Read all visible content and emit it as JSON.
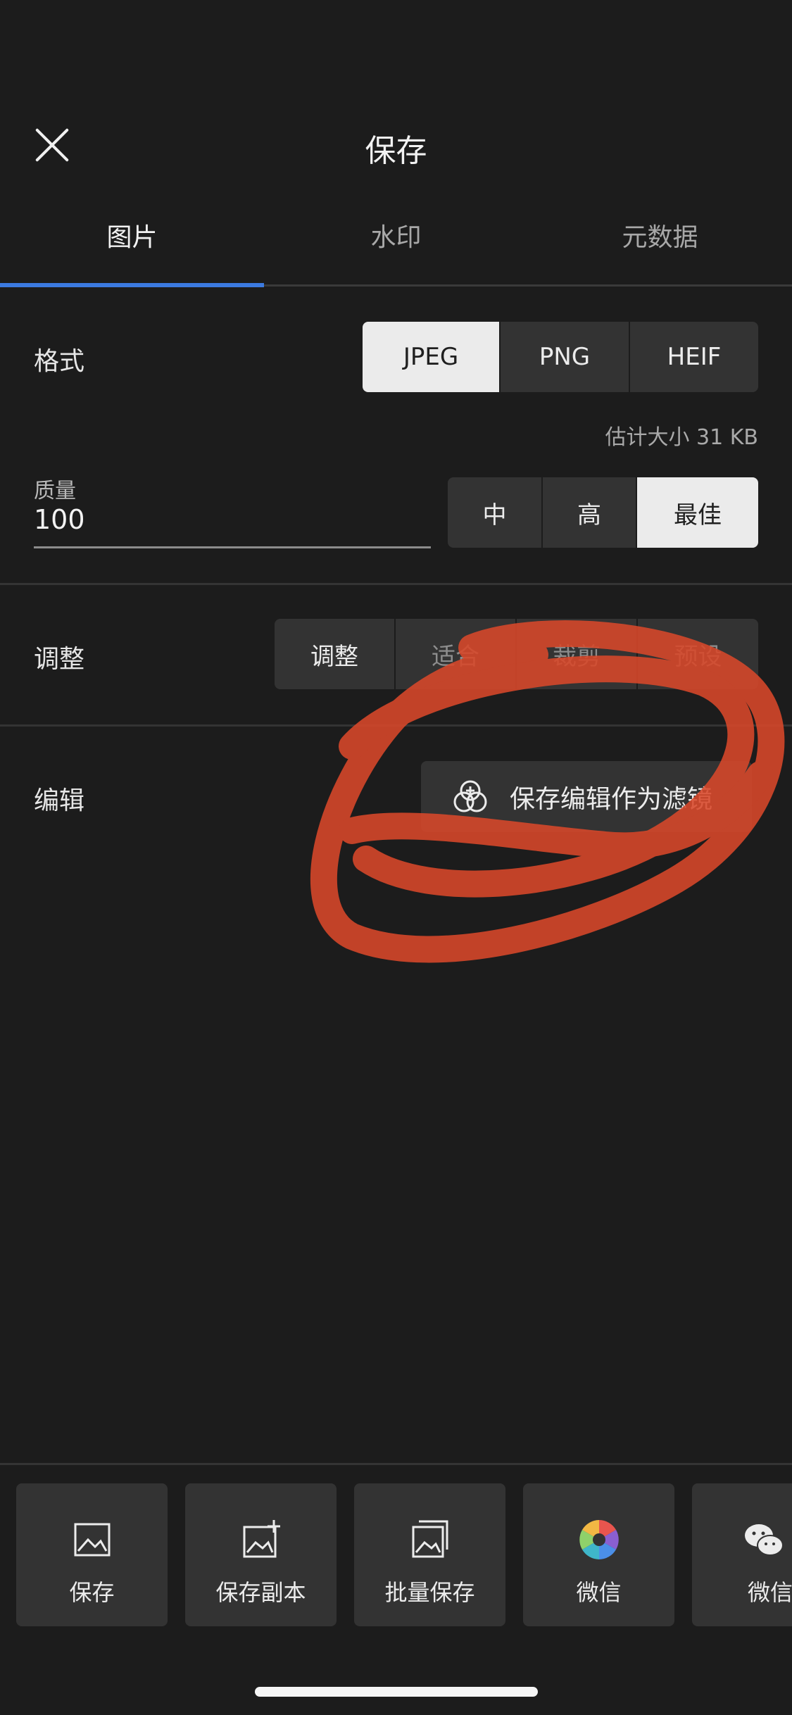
{
  "header": {
    "title": "保存"
  },
  "tabs": [
    {
      "label": "图片",
      "active": true
    },
    {
      "label": "水印",
      "active": false
    },
    {
      "label": "元数据",
      "active": false
    }
  ],
  "format": {
    "label": "格式",
    "options": [
      "JPEG",
      "PNG",
      "HEIF"
    ],
    "selected": "JPEG",
    "estimated_size": "估计大小 31 KB"
  },
  "quality": {
    "label": "质量",
    "value": "100",
    "presets": [
      "中",
      "高",
      "最佳"
    ],
    "selected": "最佳"
  },
  "adjust": {
    "label": "调整",
    "options": [
      "调整",
      "适合",
      "裁剪",
      "预设"
    ],
    "selected": "调整"
  },
  "edit": {
    "label": "编辑",
    "save_filter_label": "保存编辑作为滤镜"
  },
  "actions": [
    {
      "label": "保存",
      "icon": "image-icon"
    },
    {
      "label": "保存副本",
      "icon": "image-plus-icon"
    },
    {
      "label": "批量保存",
      "icon": "image-stack-icon"
    },
    {
      "label": "微信",
      "icon": "shutter-app-icon"
    },
    {
      "label": "微信",
      "icon": "wechat-icon"
    }
  ],
  "colors": {
    "accent": "#3c7ae0",
    "annotation": "#d9482a",
    "background": "#1c1c1c"
  }
}
